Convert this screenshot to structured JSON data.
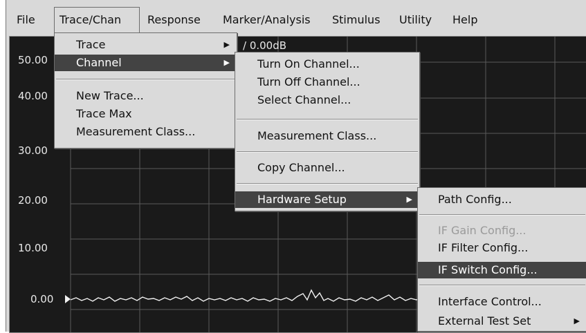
{
  "menubar": {
    "items": [
      "File",
      "Trace/Chan",
      "Response",
      "Marker/Analysis",
      "Stimulus",
      "Utility",
      "Help"
    ]
  },
  "trace_header": "/ 0.00dB",
  "y_axis_labels": [
    "50.00",
    "40.00",
    "30.00",
    "20.00",
    "10.00",
    "0.00"
  ],
  "trace_chan_menu": {
    "items": [
      {
        "label": "Trace",
        "submenu": true
      },
      {
        "label": "Channel",
        "submenu": true,
        "highlighted": true
      },
      {
        "label": "New Trace..."
      },
      {
        "label": "Trace Max"
      },
      {
        "label": "Measurement Class..."
      }
    ]
  },
  "channel_menu": {
    "items": [
      {
        "label": "Turn On Channel..."
      },
      {
        "label": "Turn Off Channel..."
      },
      {
        "label": "Select Channel..."
      },
      {
        "label": "Measurement Class..."
      },
      {
        "label": "Copy Channel..."
      },
      {
        "label": "Hardware Setup",
        "submenu": true,
        "highlighted": true
      }
    ]
  },
  "hardware_setup_menu": {
    "items": [
      {
        "label": "Path Config..."
      },
      {
        "label": "IF Gain Config...",
        "disabled": true
      },
      {
        "label": "IF Filter Config..."
      },
      {
        "label": "IF Switch Config...",
        "highlighted": true
      },
      {
        "label": "Interface Control..."
      },
      {
        "label": "External Test Set",
        "submenu": true
      }
    ]
  },
  "icons": {
    "submenu_arrow": "right-triangle",
    "reference_marker": "right-triangle"
  },
  "colors": {
    "menu_bg": "#dadada",
    "highlight_bg": "#434343",
    "highlight_fg": "#ffffff",
    "plot_bg": "#1a1a1a",
    "grid": "#5a5a5a",
    "trace": "#f0f0f0",
    "disabled_text": "#9a9a9a"
  }
}
